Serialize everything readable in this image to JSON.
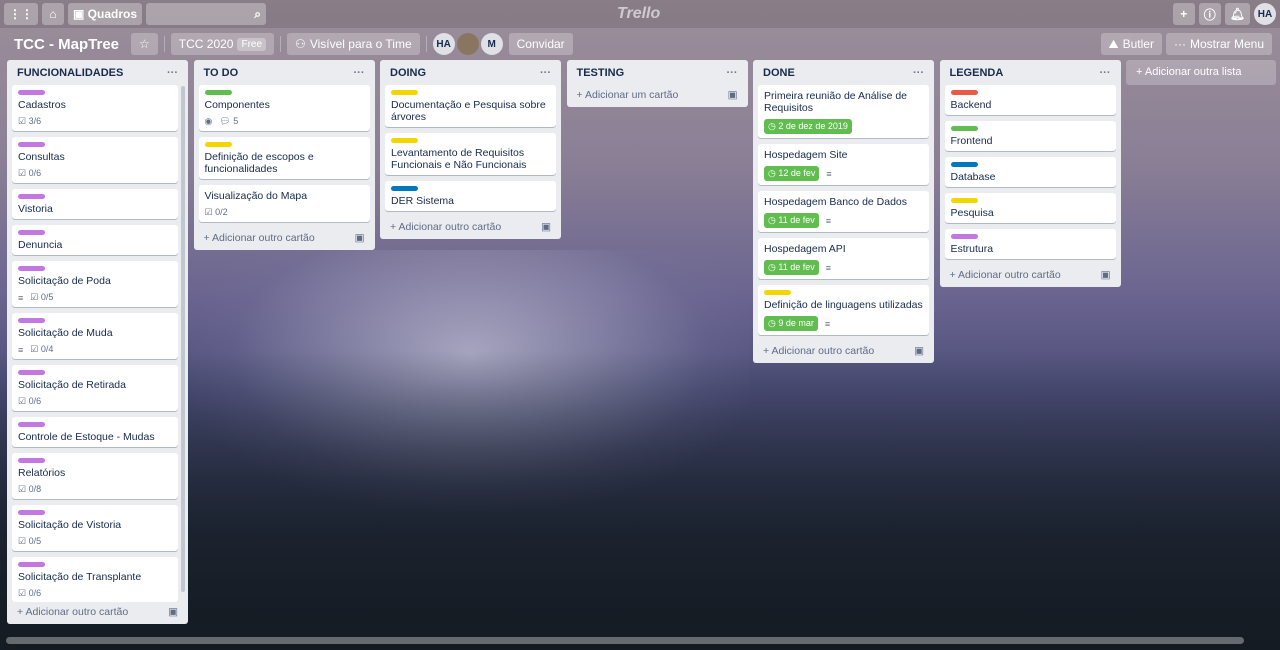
{
  "topbar": {
    "boards_label": "Quadros",
    "logo": "Trello",
    "user_initials": "HA",
    "icons": [
      "apps-icon",
      "home-icon",
      "board-icon",
      "search-icon",
      "plus-icon",
      "info-icon",
      "bell-icon"
    ]
  },
  "board": {
    "title": "TCC - MapTree",
    "team": "TCC 2020",
    "plan_badge": "Free",
    "visibility": "Visível para o Time",
    "members": [
      "HA",
      "",
      "M"
    ],
    "invite": "Convidar",
    "butler": "Butler",
    "menu": "Mostrar Menu"
  },
  "lists": [
    {
      "title": "FUNCIONALIDADES",
      "scroll": true,
      "add": "Adicionar outro cartão",
      "cards": [
        {
          "label": "#c377e0",
          "title": "Cadastros",
          "checklist": "3/6"
        },
        {
          "label": "#c377e0",
          "title": "Consultas",
          "checklist": "0/6"
        },
        {
          "label": "#c377e0",
          "title": "Vistoria"
        },
        {
          "label": "#c377e0",
          "title": "Denuncia"
        },
        {
          "label": "#c377e0",
          "title": "Solicitação de Poda",
          "desc": true,
          "checklist": "0/5"
        },
        {
          "label": "#c377e0",
          "title": "Solicitação de Muda",
          "desc": true,
          "checklist": "0/4"
        },
        {
          "label": "#c377e0",
          "title": "Solicitação de Retirada",
          "checklist": "0/6"
        },
        {
          "label": "#c377e0",
          "title": "Controle de Estoque - Mudas"
        },
        {
          "label": "#c377e0",
          "title": "Relatórios",
          "checklist": "0/8"
        },
        {
          "label": "#c377e0",
          "title": "Solicitação de Vistoria",
          "checklist": "0/5"
        },
        {
          "label": "#c377e0",
          "title": "Solicitação de Transplante",
          "checklist": "0/6"
        }
      ]
    },
    {
      "title": "TO DO",
      "add": "Adicionar outro cartão",
      "cards": [
        {
          "label": "#61bd4f",
          "title": "Componentes",
          "watch": true,
          "comments": "5"
        },
        {
          "label": "#f2d600",
          "title": "Definição de escopos e funcionalidades"
        },
        {
          "title": "Visualização do Mapa",
          "checklist": "0/2"
        }
      ]
    },
    {
      "title": "DOING",
      "add": "Adicionar outro cartão",
      "cards": [
        {
          "label": "#f2d600",
          "title": "Documentação e Pesquisa sobre árvores"
        },
        {
          "label": "#f2d600",
          "title": "Levantamento de Requisitos Funcionais e Não Funcionais"
        },
        {
          "label": "#0079bf",
          "title": "DER Sistema"
        }
      ]
    },
    {
      "title": "TESTING",
      "add": "Adicionar um cartão",
      "cards": []
    },
    {
      "title": "DONE",
      "add": "Adicionar outro cartão",
      "cards": [
        {
          "title": "Primeira reunião de Análise de Requisitos",
          "due": "2 de dez de 2019"
        },
        {
          "title": "Hospedagem Site",
          "due": "12 de fev",
          "desc": true
        },
        {
          "title": "Hospedagem Banco de Dados",
          "due": "11 de fev",
          "desc": true
        },
        {
          "title": "Hospedagem API",
          "due": "11 de fev",
          "desc": true
        },
        {
          "label": "#f2d600",
          "title": "Definição de linguagens utilizadas",
          "due": "9 de mar",
          "desc": true
        }
      ]
    },
    {
      "title": "LEGENDA",
      "add": "Adicionar outro cartão",
      "cards": [
        {
          "label": "#eb5a46",
          "title": "Backend"
        },
        {
          "label": "#61bd4f",
          "title": "Frontend"
        },
        {
          "label": "#0079bf",
          "title": "Database"
        },
        {
          "label": "#f2d600",
          "title": "Pesquisa"
        },
        {
          "label": "#c377e0",
          "title": "Estrutura"
        }
      ]
    }
  ],
  "add_list": "Adicionar outra lista"
}
